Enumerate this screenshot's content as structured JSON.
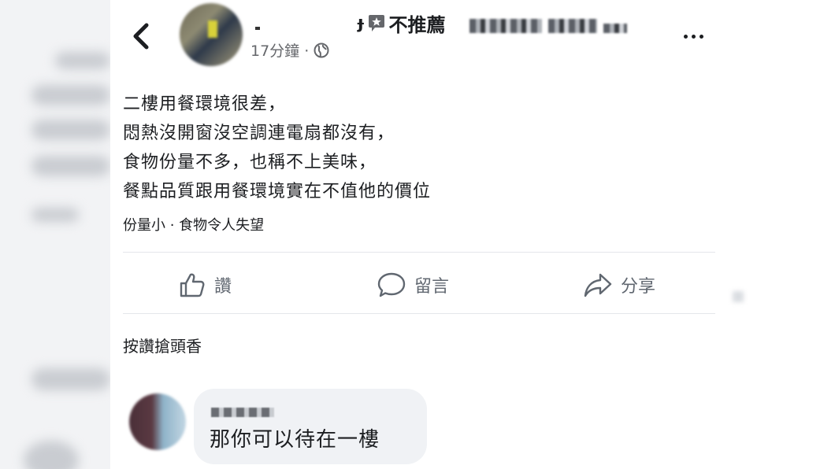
{
  "header": {
    "title_mark": "ɟ",
    "recommend_label": "不推薦",
    "timestamp": "17分鐘 ·"
  },
  "post": {
    "lines": [
      "二樓用餐環境很差，",
      "悶熱沒開窗沒空調連電扇都沒有，",
      "食物份量不多，也稱不上美味，",
      "餐點品質跟用餐環境實在不值他的價位"
    ],
    "tags": "份量小 · 食物令人失望"
  },
  "actions": {
    "like": "讚",
    "comment": "留言",
    "share": "分享"
  },
  "first_like": "按讚搶頭香",
  "comment": {
    "text": "那你可以待在一樓"
  },
  "icons": [
    "back-arrow-icon",
    "not-recommend-icon",
    "globe-icon",
    "more-icon",
    "thumbs-up-icon",
    "comment-icon",
    "share-icon"
  ]
}
